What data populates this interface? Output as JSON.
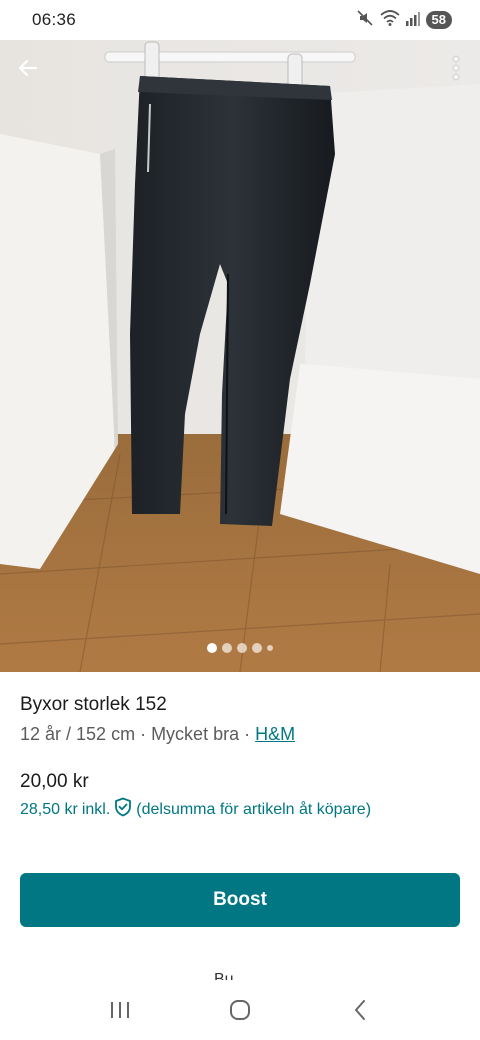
{
  "status_bar": {
    "time": "06:36",
    "battery": "58",
    "icons": [
      "mute-icon",
      "wifi-icon",
      "signal-icon"
    ]
  },
  "photo": {
    "alt": "Svarta byxor",
    "page_count": 5,
    "active_index": 0
  },
  "item": {
    "title": "Byxor storlek 152",
    "age_size": "12 år / 152 cm",
    "separator": " · ",
    "condition": "Mycket bra",
    "brand": "H&M",
    "price": "20,00 kr",
    "price_incl": "28,50 kr",
    "incl_label": "inkl.",
    "incl_note": "(delsumma för artikeln åt köpare)"
  },
  "actions": {
    "boost_label": "Boost",
    "peek_label": "Bu"
  },
  "colors": {
    "accent": "#007782"
  }
}
